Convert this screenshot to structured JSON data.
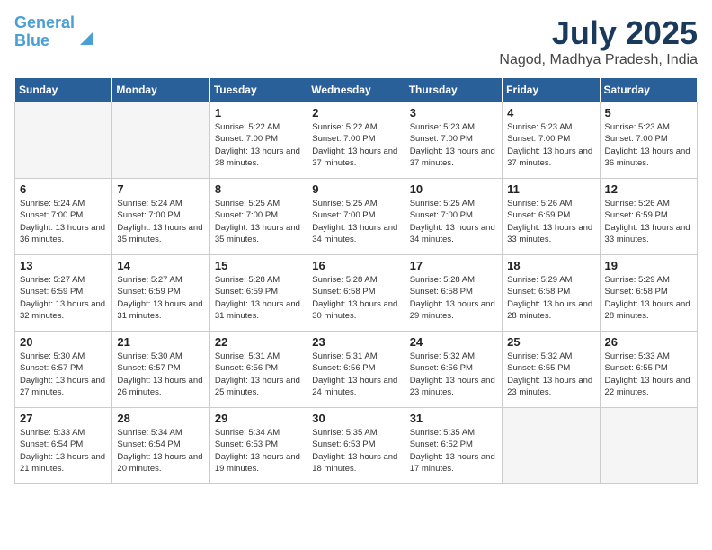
{
  "header": {
    "logo_line1": "General",
    "logo_line2": "Blue",
    "month_year": "July 2025",
    "location": "Nagod, Madhya Pradesh, India"
  },
  "weekdays": [
    "Sunday",
    "Monday",
    "Tuesday",
    "Wednesday",
    "Thursday",
    "Friday",
    "Saturday"
  ],
  "weeks": [
    [
      {
        "day": "",
        "info": ""
      },
      {
        "day": "",
        "info": ""
      },
      {
        "day": "1",
        "info": "Sunrise: 5:22 AM\nSunset: 7:00 PM\nDaylight: 13 hours\nand 38 minutes."
      },
      {
        "day": "2",
        "info": "Sunrise: 5:22 AM\nSunset: 7:00 PM\nDaylight: 13 hours\nand 37 minutes."
      },
      {
        "day": "3",
        "info": "Sunrise: 5:23 AM\nSunset: 7:00 PM\nDaylight: 13 hours\nand 37 minutes."
      },
      {
        "day": "4",
        "info": "Sunrise: 5:23 AM\nSunset: 7:00 PM\nDaylight: 13 hours\nand 37 minutes."
      },
      {
        "day": "5",
        "info": "Sunrise: 5:23 AM\nSunset: 7:00 PM\nDaylight: 13 hours\nand 36 minutes."
      }
    ],
    [
      {
        "day": "6",
        "info": "Sunrise: 5:24 AM\nSunset: 7:00 PM\nDaylight: 13 hours\nand 36 minutes."
      },
      {
        "day": "7",
        "info": "Sunrise: 5:24 AM\nSunset: 7:00 PM\nDaylight: 13 hours\nand 35 minutes."
      },
      {
        "day": "8",
        "info": "Sunrise: 5:25 AM\nSunset: 7:00 PM\nDaylight: 13 hours\nand 35 minutes."
      },
      {
        "day": "9",
        "info": "Sunrise: 5:25 AM\nSunset: 7:00 PM\nDaylight: 13 hours\nand 34 minutes."
      },
      {
        "day": "10",
        "info": "Sunrise: 5:25 AM\nSunset: 7:00 PM\nDaylight: 13 hours\nand 34 minutes."
      },
      {
        "day": "11",
        "info": "Sunrise: 5:26 AM\nSunset: 6:59 PM\nDaylight: 13 hours\nand 33 minutes."
      },
      {
        "day": "12",
        "info": "Sunrise: 5:26 AM\nSunset: 6:59 PM\nDaylight: 13 hours\nand 33 minutes."
      }
    ],
    [
      {
        "day": "13",
        "info": "Sunrise: 5:27 AM\nSunset: 6:59 PM\nDaylight: 13 hours\nand 32 minutes."
      },
      {
        "day": "14",
        "info": "Sunrise: 5:27 AM\nSunset: 6:59 PM\nDaylight: 13 hours\nand 31 minutes."
      },
      {
        "day": "15",
        "info": "Sunrise: 5:28 AM\nSunset: 6:59 PM\nDaylight: 13 hours\nand 31 minutes."
      },
      {
        "day": "16",
        "info": "Sunrise: 5:28 AM\nSunset: 6:58 PM\nDaylight: 13 hours\nand 30 minutes."
      },
      {
        "day": "17",
        "info": "Sunrise: 5:28 AM\nSunset: 6:58 PM\nDaylight: 13 hours\nand 29 minutes."
      },
      {
        "day": "18",
        "info": "Sunrise: 5:29 AM\nSunset: 6:58 PM\nDaylight: 13 hours\nand 28 minutes."
      },
      {
        "day": "19",
        "info": "Sunrise: 5:29 AM\nSunset: 6:58 PM\nDaylight: 13 hours\nand 28 minutes."
      }
    ],
    [
      {
        "day": "20",
        "info": "Sunrise: 5:30 AM\nSunset: 6:57 PM\nDaylight: 13 hours\nand 27 minutes."
      },
      {
        "day": "21",
        "info": "Sunrise: 5:30 AM\nSunset: 6:57 PM\nDaylight: 13 hours\nand 26 minutes."
      },
      {
        "day": "22",
        "info": "Sunrise: 5:31 AM\nSunset: 6:56 PM\nDaylight: 13 hours\nand 25 minutes."
      },
      {
        "day": "23",
        "info": "Sunrise: 5:31 AM\nSunset: 6:56 PM\nDaylight: 13 hours\nand 24 minutes."
      },
      {
        "day": "24",
        "info": "Sunrise: 5:32 AM\nSunset: 6:56 PM\nDaylight: 13 hours\nand 23 minutes."
      },
      {
        "day": "25",
        "info": "Sunrise: 5:32 AM\nSunset: 6:55 PM\nDaylight: 13 hours\nand 23 minutes."
      },
      {
        "day": "26",
        "info": "Sunrise: 5:33 AM\nSunset: 6:55 PM\nDaylight: 13 hours\nand 22 minutes."
      }
    ],
    [
      {
        "day": "27",
        "info": "Sunrise: 5:33 AM\nSunset: 6:54 PM\nDaylight: 13 hours\nand 21 minutes."
      },
      {
        "day": "28",
        "info": "Sunrise: 5:34 AM\nSunset: 6:54 PM\nDaylight: 13 hours\nand 20 minutes."
      },
      {
        "day": "29",
        "info": "Sunrise: 5:34 AM\nSunset: 6:53 PM\nDaylight: 13 hours\nand 19 minutes."
      },
      {
        "day": "30",
        "info": "Sunrise: 5:35 AM\nSunset: 6:53 PM\nDaylight: 13 hours\nand 18 minutes."
      },
      {
        "day": "31",
        "info": "Sunrise: 5:35 AM\nSunset: 6:52 PM\nDaylight: 13 hours\nand 17 minutes."
      },
      {
        "day": "",
        "info": ""
      },
      {
        "day": "",
        "info": ""
      }
    ]
  ]
}
